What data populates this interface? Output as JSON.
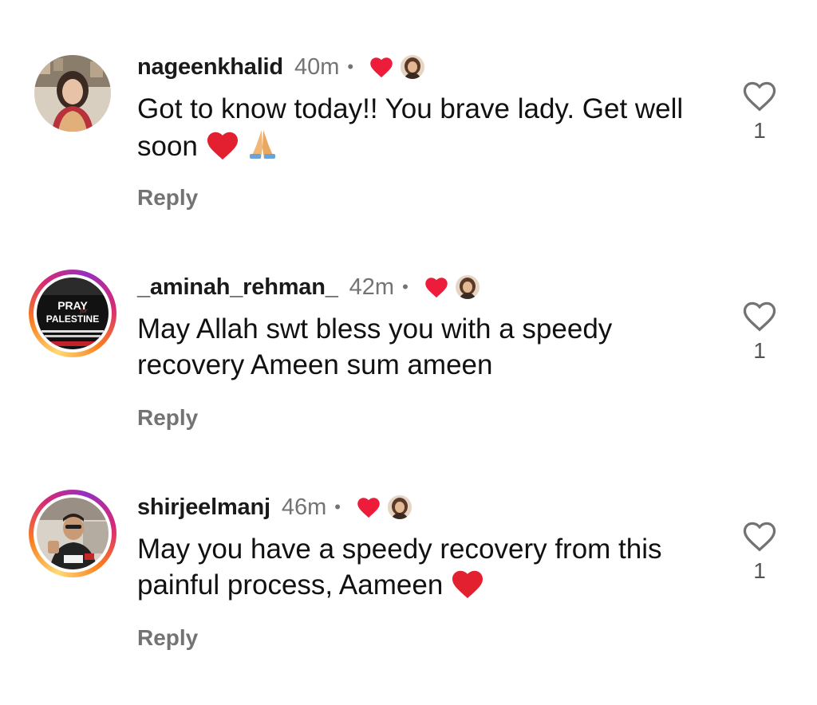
{
  "colors": {
    "background": "#ffffff",
    "heart_red": "#ed1c3a",
    "muted_text": "#737373",
    "story_ring": [
      "#feda75",
      "#fa7e1e",
      "#d62976",
      "#962fbf"
    ]
  },
  "comments": [
    {
      "username": "nageenkhalid",
      "time": "40m",
      "separator": "•",
      "text": "Got to know today!! You brave lady. Get well soon",
      "emojis": [
        "red-heart",
        "folded-hands"
      ],
      "reply_label": "Reply",
      "like_count": "1",
      "liked_by_creator": true,
      "avatar": "woman-portrait",
      "story_ring": false
    },
    {
      "username": "_aminah_rehman_",
      "time": "42m",
      "separator": "•",
      "text": "May Allah swt bless you with a speedy recovery Ameen sum ameen",
      "emojis": [],
      "reply_label": "Reply",
      "like_count": "1",
      "liked_by_creator": true,
      "avatar": "pray-for-palestine-graphic",
      "avatar_text": [
        "PRAY",
        "for",
        "PALESTINE"
      ],
      "story_ring": true
    },
    {
      "username": "shirjeelmanj",
      "time": "46m",
      "separator": "•",
      "text": "May you have a speedy recovery from this painful process, Aameen",
      "emojis": [
        "red-heart"
      ],
      "reply_label": "Reply",
      "like_count": "1",
      "liked_by_creator": true,
      "avatar": "man-in-car-portrait",
      "story_ring": true
    }
  ]
}
